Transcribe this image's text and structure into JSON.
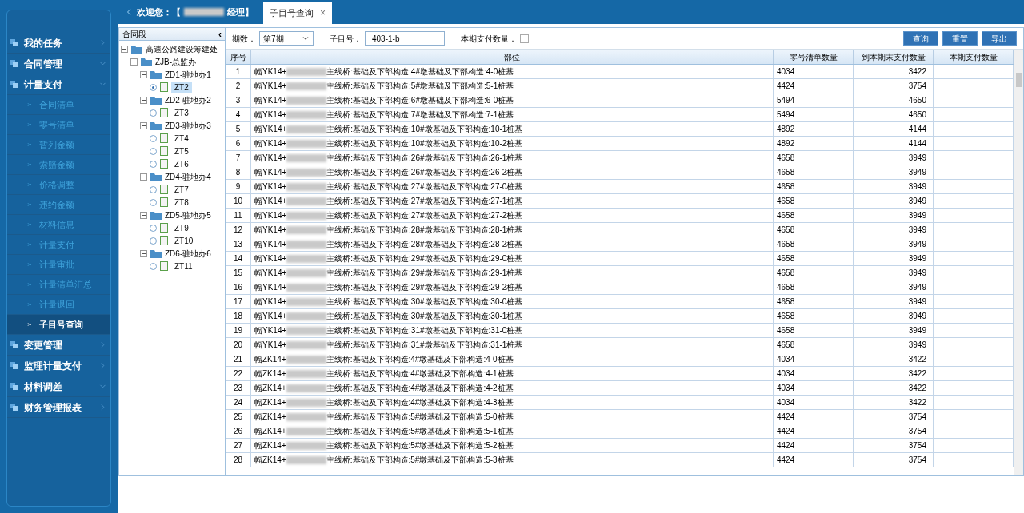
{
  "header": {
    "welcome_prefix": "欢迎您：【",
    "welcome_suffix": "经理】"
  },
  "tabs": [
    {
      "label": "子目号查询",
      "selected": true,
      "close": "×"
    }
  ],
  "sidebar": {
    "items": [
      {
        "label": "我的任务",
        "expanded": false
      },
      {
        "label": "合同管理",
        "expanded": true
      },
      {
        "label": "计量支付",
        "expanded": true,
        "children": [
          {
            "label": "合同清单",
            "selected": false
          },
          {
            "label": "零号清单",
            "selected": false
          },
          {
            "label": "暂列金额",
            "selected": false
          },
          {
            "label": "索赔金额",
            "selected": false
          },
          {
            "label": "价格调整",
            "selected": false
          },
          {
            "label": "违约金额",
            "selected": false
          },
          {
            "label": "材料信息",
            "selected": false
          },
          {
            "label": "计量支付",
            "selected": false
          },
          {
            "label": "计量审批",
            "selected": false
          },
          {
            "label": "计量清单汇总",
            "selected": false
          },
          {
            "label": "计量退回",
            "selected": false
          },
          {
            "label": "子目号查询",
            "selected": true
          }
        ]
      },
      {
        "label": "变更管理",
        "expanded": false
      },
      {
        "label": "监理计量支付",
        "expanded": false
      },
      {
        "label": "材料调差",
        "expanded": true
      },
      {
        "label": "财务管理报表",
        "expanded": false
      }
    ]
  },
  "tree": {
    "title": "合同段",
    "collapse": "‹",
    "nodes": [
      {
        "label": "高速公路建设筹建处",
        "children": [
          {
            "label": "ZJB-总监办",
            "children": [
              {
                "label": "ZD1-驻地办1",
                "children": [
                  {
                    "label": "ZT2",
                    "selected": true
                  }
                ]
              },
              {
                "label": "ZD2-驻地办2",
                "children": [
                  {
                    "label": "ZT3",
                    "selected": false
                  }
                ]
              },
              {
                "label": "ZD3-驻地办3",
                "children": [
                  {
                    "label": "ZT4",
                    "selected": false
                  },
                  {
                    "label": "ZT5",
                    "selected": false
                  },
                  {
                    "label": "ZT6",
                    "selected": false
                  }
                ]
              },
              {
                "label": "ZD4-驻地办4",
                "children": [
                  {
                    "label": "ZT7",
                    "selected": false
                  },
                  {
                    "label": "ZT8",
                    "selected": false
                  }
                ]
              },
              {
                "label": "ZD5-驻地办5",
                "children": [
                  {
                    "label": "ZT9",
                    "selected": false
                  },
                  {
                    "label": "ZT10",
                    "selected": false
                  }
                ]
              },
              {
                "label": "ZD6-驻地办6",
                "children": [
                  {
                    "label": "ZT11",
                    "selected": false
                  }
                ]
              }
            ]
          }
        ]
      }
    ]
  },
  "filters": {
    "period_label": "期数：",
    "period_value": "第7期",
    "item_label": "子目号：",
    "item_value": "403-1-b",
    "pay_label": "本期支付数量：",
    "pay_checked": false
  },
  "buttons": [
    "查询",
    "重置",
    "导出"
  ],
  "table": {
    "columns": [
      "序号",
      "部位",
      "零号清单数量",
      "到本期末支付数量",
      "本期支付数量"
    ],
    "rows": [
      {
        "no": "1",
        "prefix": "幅YK14+",
        "location": "主线桥:基础及下部构造:4#墩基础及下部构造:4-0桩基",
        "zero_qty": "4034",
        "paid_qty": "3422"
      },
      {
        "no": "2",
        "prefix": "幅YK14+",
        "location": "主线桥:基础及下部构造:5#墩基础及下部构造:5-1桩基",
        "zero_qty": "4424",
        "paid_qty": "3754"
      },
      {
        "no": "3",
        "prefix": "幅YK14+",
        "location": "主线桥:基础及下部构造:6#墩基础及下部构造:6-0桩基",
        "zero_qty": "5494",
        "paid_qty": "4650"
      },
      {
        "no": "4",
        "prefix": "幅YK14+",
        "location": "主线桥:基础及下部构造:7#墩基础及下部构造:7-1桩基",
        "zero_qty": "5494",
        "paid_qty": "4650"
      },
      {
        "no": "5",
        "prefix": "幅YK14+",
        "location": "主线桥:基础及下部构造:10#墩基础及下部构造:10-1桩基",
        "zero_qty": "4892",
        "paid_qty": "4144"
      },
      {
        "no": "6",
        "prefix": "幅YK14+",
        "location": "主线桥:基础及下部构造:10#墩基础及下部构造:10-2桩基",
        "zero_qty": "4892",
        "paid_qty": "4144"
      },
      {
        "no": "7",
        "prefix": "幅YK14+",
        "location": "主线桥:基础及下部构造:26#墩基础及下部构造:26-1桩基",
        "zero_qty": "4658",
        "paid_qty": "3949"
      },
      {
        "no": "8",
        "prefix": "幅YK14+",
        "location": "主线桥:基础及下部构造:26#墩基础及下部构造:26-2桩基",
        "zero_qty": "4658",
        "paid_qty": "3949"
      },
      {
        "no": "9",
        "prefix": "幅YK14+",
        "location": "主线桥:基础及下部构造:27#墩基础及下部构造:27-0桩基",
        "zero_qty": "4658",
        "paid_qty": "3949"
      },
      {
        "no": "10",
        "prefix": "幅YK14+",
        "location": "主线桥:基础及下部构造:27#墩基础及下部构造:27-1桩基",
        "zero_qty": "4658",
        "paid_qty": "3949"
      },
      {
        "no": "11",
        "prefix": "幅YK14+",
        "location": "主线桥:基础及下部构造:27#墩基础及下部构造:27-2桩基",
        "zero_qty": "4658",
        "paid_qty": "3949"
      },
      {
        "no": "12",
        "prefix": "幅YK14+",
        "location": "主线桥:基础及下部构造:28#墩基础及下部构造:28-1桩基",
        "zero_qty": "4658",
        "paid_qty": "3949"
      },
      {
        "no": "13",
        "prefix": "幅YK14+",
        "location": "主线桥:基础及下部构造:28#墩基础及下部构造:28-2桩基",
        "zero_qty": "4658",
        "paid_qty": "3949"
      },
      {
        "no": "14",
        "prefix": "幅YK14+",
        "location": "主线桥:基础及下部构造:29#墩基础及下部构造:29-0桩基",
        "zero_qty": "4658",
        "paid_qty": "3949"
      },
      {
        "no": "15",
        "prefix": "幅YK14+",
        "location": "主线桥:基础及下部构造:29#墩基础及下部构造:29-1桩基",
        "zero_qty": "4658",
        "paid_qty": "3949"
      },
      {
        "no": "16",
        "prefix": "幅YK14+",
        "location": "主线桥:基础及下部构造:29#墩基础及下部构造:29-2桩基",
        "zero_qty": "4658",
        "paid_qty": "3949"
      },
      {
        "no": "17",
        "prefix": "幅YK14+",
        "location": "主线桥:基础及下部构造:30#墩基础及下部构造:30-0桩基",
        "zero_qty": "4658",
        "paid_qty": "3949"
      },
      {
        "no": "18",
        "prefix": "幅YK14+",
        "location": "主线桥:基础及下部构造:30#墩基础及下部构造:30-1桩基",
        "zero_qty": "4658",
        "paid_qty": "3949"
      },
      {
        "no": "19",
        "prefix": "幅YK14+",
        "location": "主线桥:基础及下部构造:31#墩基础及下部构造:31-0桩基",
        "zero_qty": "4658",
        "paid_qty": "3949"
      },
      {
        "no": "20",
        "prefix": "幅YK14+",
        "location": "主线桥:基础及下部构造:31#墩基础及下部构造:31-1桩基",
        "zero_qty": "4658",
        "paid_qty": "3949"
      },
      {
        "no": "21",
        "prefix": "幅ZK14+",
        "location": "主线桥:基础及下部构造:4#墩基础及下部构造:4-0桩基",
        "zero_qty": "4034",
        "paid_qty": "3422"
      },
      {
        "no": "22",
        "prefix": "幅ZK14+",
        "location": "主线桥:基础及下部构造:4#墩基础及下部构造:4-1桩基",
        "zero_qty": "4034",
        "paid_qty": "3422"
      },
      {
        "no": "23",
        "prefix": "幅ZK14+",
        "location": "主线桥:基础及下部构造:4#墩基础及下部构造:4-2桩基",
        "zero_qty": "4034",
        "paid_qty": "3422"
      },
      {
        "no": "24",
        "prefix": "幅ZK14+",
        "location": "主线桥:基础及下部构造:4#墩基础及下部构造:4-3桩基",
        "zero_qty": "4034",
        "paid_qty": "3422"
      },
      {
        "no": "25",
        "prefix": "幅ZK14+",
        "location": "主线桥:基础及下部构造:5#墩基础及下部构造:5-0桩基",
        "zero_qty": "4424",
        "paid_qty": "3754"
      },
      {
        "no": "26",
        "prefix": "幅ZK14+",
        "location": "主线桥:基础及下部构造:5#墩基础及下部构造:5-1桩基",
        "zero_qty": "4424",
        "paid_qty": "3754"
      },
      {
        "no": "27",
        "prefix": "幅ZK14+",
        "location": "主线桥:基础及下部构造:5#墩基础及下部构造:5-2桩基",
        "zero_qty": "4424",
        "paid_qty": "3754"
      },
      {
        "no": "28",
        "prefix": "幅ZK14+",
        "location": "主线桥:基础及下部构造:5#墩基础及下部构造:5-3桩基",
        "zero_qty": "4424",
        "paid_qty": "3754"
      }
    ]
  }
}
